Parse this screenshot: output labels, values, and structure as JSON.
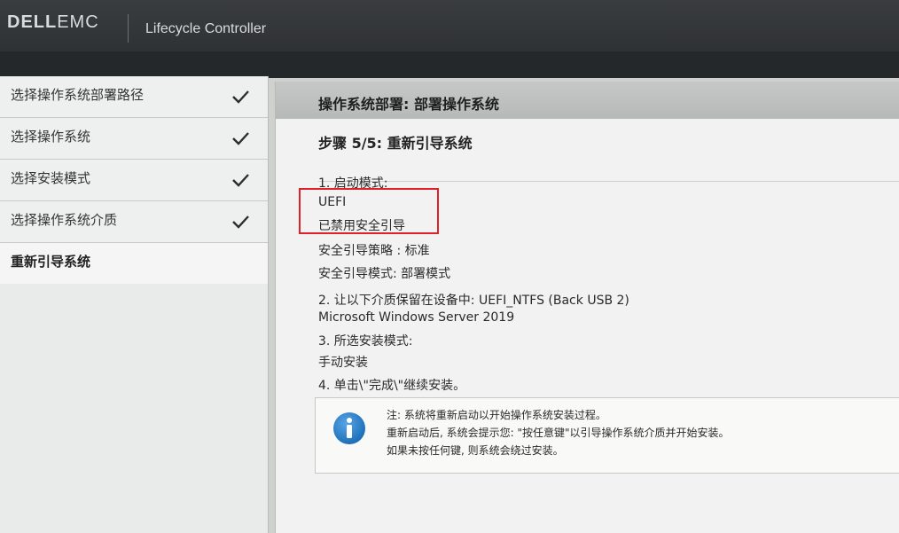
{
  "header": {
    "brand_dell": "DELL",
    "brand_emc": "EMC",
    "product": "Lifecycle Controller"
  },
  "sidebar": {
    "items": [
      {
        "label": "选择操作系统部署路径",
        "done": true
      },
      {
        "label": "选择操作系统",
        "done": true
      },
      {
        "label": "选择安装模式",
        "done": true
      },
      {
        "label": "选择操作系统介质",
        "done": true
      },
      {
        "label": "重新引导系统",
        "done": false
      }
    ]
  },
  "main": {
    "title": "操作系统部署: 部署操作系统",
    "step": "步骤 5/5: 重新引导系统",
    "lines": [
      "1. 启动模式:",
      "UEFI",
      "已禁用安全引导",
      "安全引导策略 : 标准",
      "安全引导模式: 部署模式",
      "2. 让以下介质保留在设备中: UEFI_NTFS (Back USB 2)",
      "Microsoft Windows Server 2019",
      "3. 所选安装模式:",
      "手动安装",
      "4. 单击\\\"完成\\\"继续安装。"
    ],
    "notice": {
      "icon": "info-icon",
      "lines": [
        "注: 系统将重新启动以开始操作系统安装过程。",
        "重新启动后, 系统会提示您: \"按任意键\"以引导操作系统介质并开始安装。",
        "如果未按任何键, 则系统会绕过安装。"
      ]
    }
  },
  "colors": {
    "highlight_border": "#e0212a",
    "header_bar": "#2b2e31",
    "info_icon": "#1b6fb8"
  }
}
